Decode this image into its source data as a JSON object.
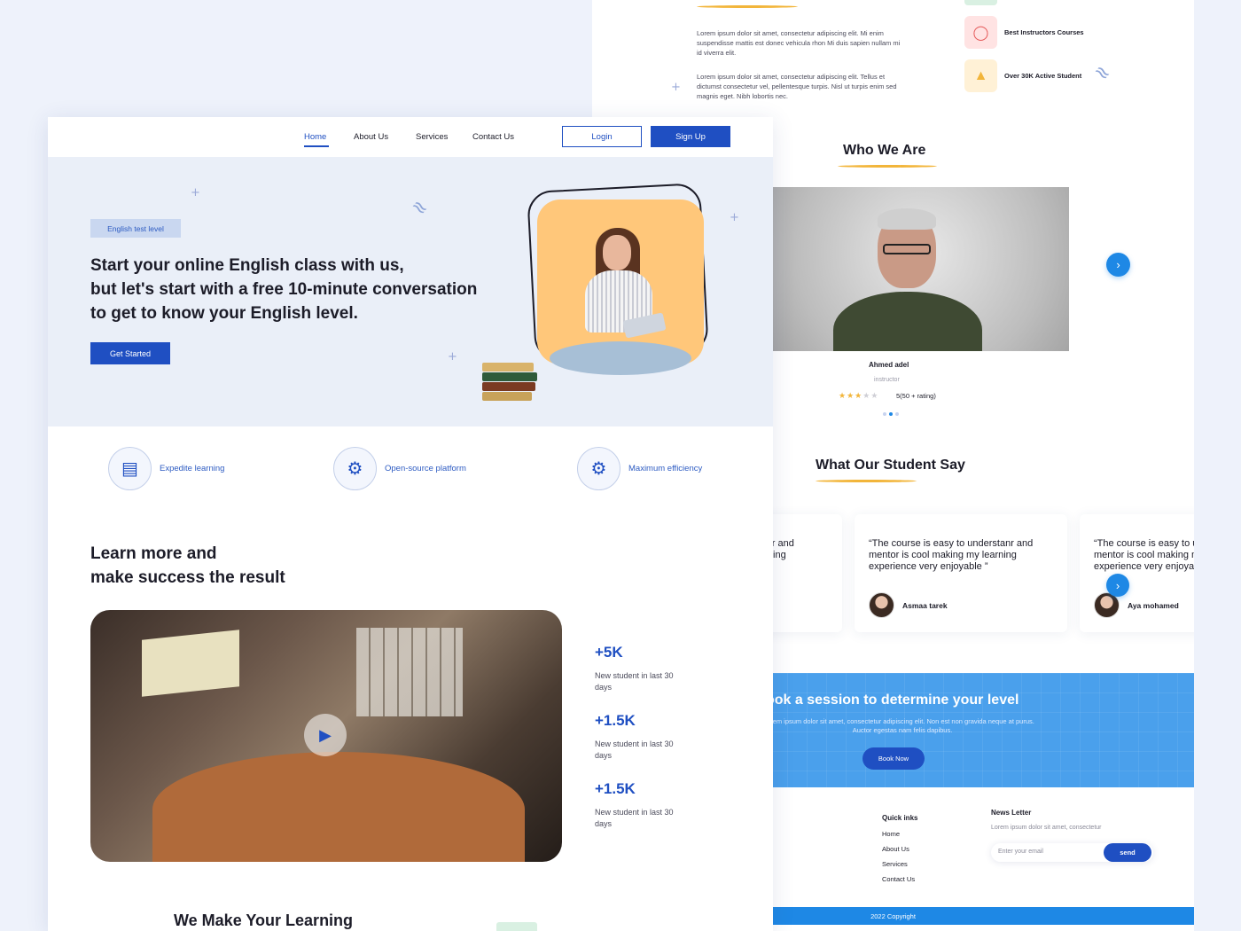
{
  "back_page": {
    "intro_paragraphs": [
      "Lorem ipsum dolor sit amet, consectetur adipiscing elit. Mi enim suspendisse mattis est donec vehicula rhon Mi duis sapien nullam mi id viverra elit.",
      "Lorem ipsum dolor sit amet, consectetur adipiscing elit. Tellus et dictumst consectetur vel, pellentesque turpis. Nisl ut turpis enim sed magnis eget. Nibh lobortis nec."
    ],
    "highlights": [
      {
        "icon": "award-icon",
        "label": "Best Instructors Courses",
        "color": "#ffe3e3"
      },
      {
        "icon": "graduation-cap-icon",
        "label": "Over 30K Active Student",
        "color": "#fff1d6"
      }
    ],
    "who_we_are": {
      "title": "Who We Are",
      "instructor_name": "Ahmed adel",
      "instructor_role": "instructor",
      "rating_stars": 3,
      "rating_max": 5,
      "rating_text": "5(50 + rating)"
    },
    "testimonials": {
      "title": "What Our Student Say",
      "items": [
        {
          "quote": "stanr and earning",
          "name": ""
        },
        {
          "quote": "“The course is easy to understanr and mentor is cool making my learning experience very enjoyable ”",
          "name": "Asmaa tarek"
        },
        {
          "quote": "“The course is easy to understanr and mentor is cool making my learning experience very enjoyable ”",
          "name": "Aya mohamed"
        }
      ]
    },
    "book": {
      "title": "ook a session to determine your level",
      "subtitle": "rem ipsum dolor sit amet, consectetur adipiscing elit. Non est non gravida neque at purus. Auctor egestas nam felis dapibus.",
      "button": "Book Now"
    },
    "footer": {
      "quick_links_title": "Quick inks",
      "links": [
        "Home",
        "About Us",
        "Services",
        "Contact Us"
      ],
      "newsletter_title": "News Letter",
      "newsletter_desc": "Lorem ipsum dolor sit amet, consectetur",
      "email_placeholder": "Enter your email",
      "send": "send",
      "copyright": "2022 Copyright"
    }
  },
  "front_page": {
    "nav": {
      "links": [
        "Home",
        "About Us",
        "Services",
        "Contact Us"
      ],
      "active": "Home",
      "login": "Login",
      "signup": "Sign Up"
    },
    "hero": {
      "tag": "English test level",
      "title_lines": [
        "Start your online English class with us,",
        "but let's start with a free 10-minute conversation",
        "to get to know your English level."
      ],
      "cta": "Get Started"
    },
    "features": [
      {
        "icon": "book-icon",
        "label": "Expedite learning"
      },
      {
        "icon": "platform-icon",
        "label": "Open-source platform"
      },
      {
        "icon": "gear-icon",
        "label": "Maximum efficiency"
      }
    ],
    "learn": {
      "title_lines": [
        "Learn more and",
        "make success the result"
      ]
    },
    "stats": [
      {
        "value": "+5K",
        "label": "New student in last 30 days"
      },
      {
        "value": "+1.5K",
        "label": "New student in last 30 days"
      },
      {
        "value": "+1.5K",
        "label": "New student in last 30 days"
      }
    ],
    "bottom_title": "We Make Your Learning"
  },
  "colors": {
    "primary": "#1f4fc2",
    "accent_blue": "#1e88e5",
    "accent_yellow": "#f2b53a",
    "hero_bg": "#eaeff8",
    "book_bg": "#4aa0ec"
  }
}
